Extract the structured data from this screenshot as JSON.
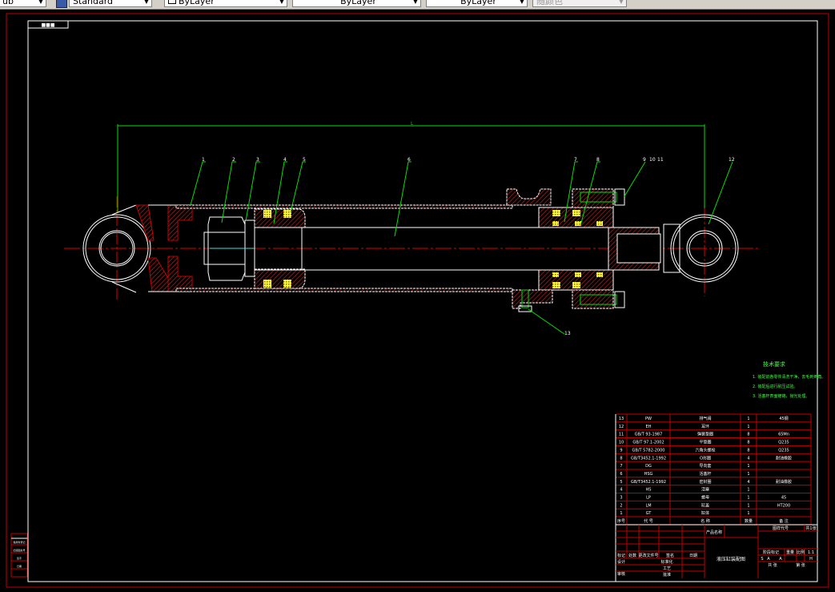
{
  "toolbar": {
    "textstyle_partial": "ub",
    "dimstyle": "Standard",
    "layer": "ByLayer",
    "linetype": "ByLayer",
    "lineweight": "ByLayer",
    "color": "随颜色"
  },
  "drawing": {
    "frame_tag": "■■■",
    "dimension_label": "L",
    "balloons": [
      "1",
      "2",
      "3",
      "4",
      "5",
      "6",
      "7",
      "8",
      "9",
      "10",
      "11",
      "12",
      "13"
    ],
    "tech_requirements": {
      "title": "技术要求",
      "lines": [
        "1. 装配前各零件清洗干净，去毛刺倒角。",
        "2. 装配后进行耐压试验。",
        "3. 活塞杆表面镀铬，抛光处理。"
      ]
    },
    "parts_list": {
      "rows": [
        [
          "13",
          "PW",
          "排气阀",
          "1",
          "45钢"
        ],
        [
          "12",
          "EH",
          "耳环",
          "1",
          ""
        ],
        [
          "11",
          "GB/T 93-1987",
          "弹簧垫圈",
          "8",
          "65Mn"
        ],
        [
          "10",
          "GB/T 97.1-2002",
          "平垫圈",
          "8",
          "Q235"
        ],
        [
          "9",
          "GB/T 5782-2000",
          "六角头螺栓",
          "8",
          "Q235"
        ],
        [
          "8",
          "GB/T3452.1-1992",
          "O形圈",
          "4",
          "耐油橡胶"
        ],
        [
          "7",
          "DG",
          "导向套",
          "1",
          ""
        ],
        [
          "6",
          "HSG",
          "活塞杆",
          "1",
          ""
        ],
        [
          "5",
          "GB/T3452.1-1992",
          "密封圈",
          "4",
          "耐油橡胶"
        ],
        [
          "4",
          "HS",
          "活塞",
          "1",
          ""
        ],
        [
          "3",
          "LP",
          "螺母",
          "1",
          "45"
        ],
        [
          "2",
          "LM",
          "缸盖",
          "1",
          "HT200"
        ],
        [
          "1",
          "GT",
          "缸体",
          "1",
          ""
        ]
      ],
      "header": [
        "序号",
        "代 号",
        "名 称",
        "数量",
        "备 注"
      ]
    },
    "title_block": {
      "product": "产品名称",
      "drawing_no": "图样代号",
      "sheet": "共1张",
      "name": "液压缸装配图",
      "stage": "阶段标记",
      "weight": "重量",
      "scale_label": "比例",
      "scale": "1:1",
      "sheets": "共 张",
      "sheet_no": "第 张",
      "mark": "标记",
      "count": "处数",
      "file": "更改文件号",
      "sign": "签名",
      "date": "日期",
      "design": "设计",
      "standard": "标准化",
      "check": "审核",
      "process": "工艺",
      "approve": "批准",
      "s": "S",
      "a1": "A",
      "a2": "A",
      "h": "H"
    },
    "side_strip": [
      "借用件登记",
      "旧底图总号",
      "签字",
      "日期"
    ]
  },
  "colors": {
    "frame": "#c00000",
    "border": "#ffffff",
    "hatch": "#b22222",
    "leader": "#00e000",
    "center": "#e00000",
    "seal": "#ffff40"
  }
}
